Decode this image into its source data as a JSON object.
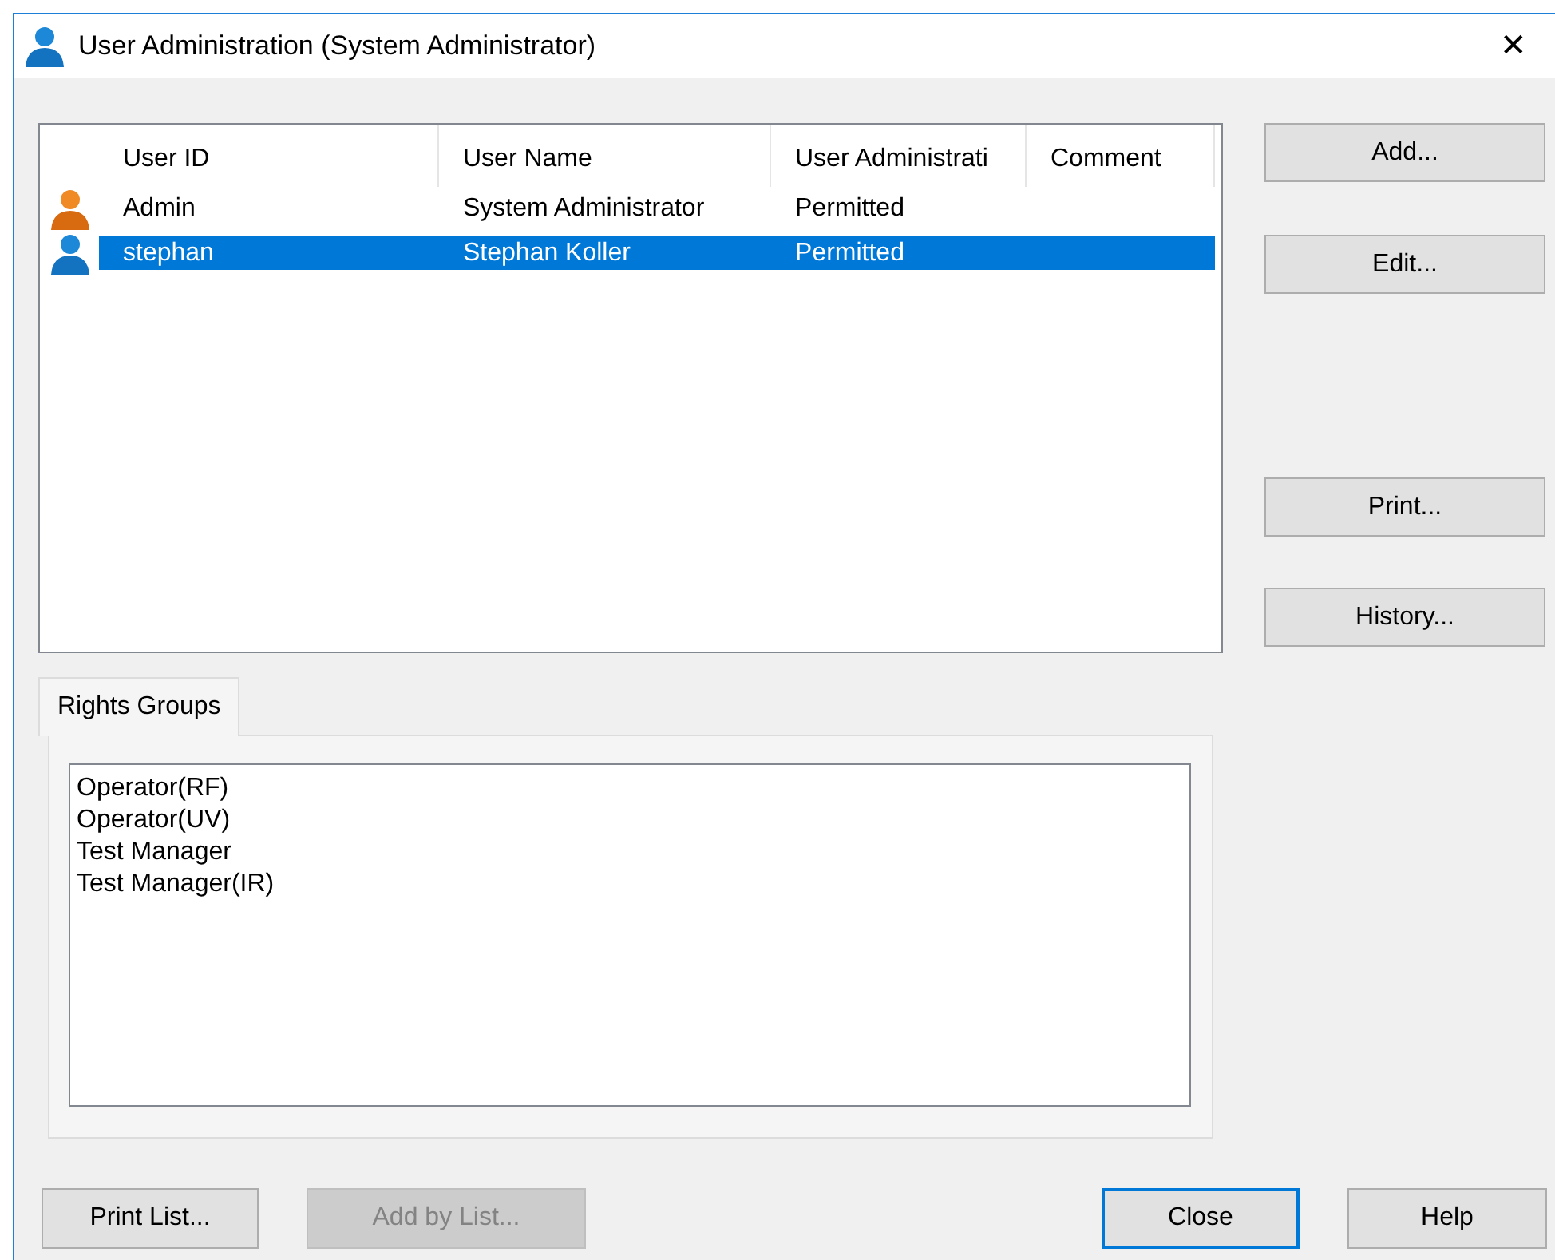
{
  "window": {
    "title": "User Administration (System Administrator)",
    "close": "✕"
  },
  "users": {
    "columns": [
      "User ID",
      "User Name",
      "User Administrati",
      "Comment"
    ],
    "rows": [
      {
        "kind": "admin",
        "selected": false,
        "cells": [
          "Admin",
          "System Administrator",
          "Permitted",
          ""
        ]
      },
      {
        "kind": "user",
        "selected": true,
        "cells": [
          "stephan",
          "Stephan Koller",
          "Permitted",
          ""
        ]
      }
    ]
  },
  "side_buttons": [
    {
      "label": "Add..."
    },
    {
      "label": "Edit..."
    },
    {
      "label": "Print..."
    },
    {
      "label": "History..."
    }
  ],
  "tabs": [
    {
      "label": "Rights Groups",
      "selected": true
    }
  ],
  "rights_groups": [
    "Operator(RF)",
    "Operator(UV)",
    "Test Manager",
    "Test Manager(IR)"
  ],
  "bottom_buttons": [
    {
      "label": "Print List...",
      "disabled": false,
      "focused": false
    },
    {
      "label": "Add by List...",
      "disabled": true,
      "focused": false
    },
    {
      "label": "Close",
      "disabled": false,
      "focused": true
    },
    {
      "label": "Help",
      "disabled": false,
      "focused": false
    }
  ]
}
